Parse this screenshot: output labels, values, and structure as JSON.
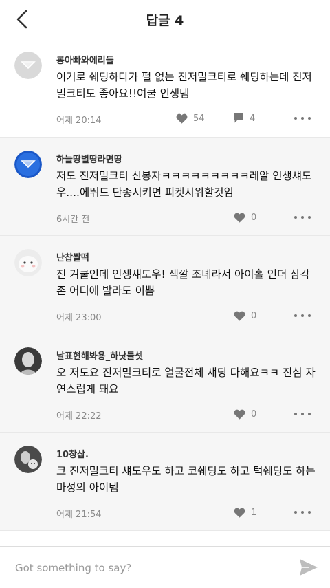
{
  "header": {
    "title": "답글 4",
    "back_icon": "chevron-left-icon"
  },
  "replies": [
    {
      "username": "쿙아빠와에리들",
      "text": "이거로 쉐딩하다가 펄 없는 진저밀크티로 쉐딩하는데 진저밀크티도 좋아요!!여쿨 인생템",
      "time": "어제 20:14",
      "likes": "54",
      "comments": "4"
    },
    {
      "username": "하늘땅별땅라면땅",
      "text": "저도 진저밀크티 신봉자ㅋㅋㅋㅋㅋㅋㅋㅋㅋ레알 인생섀도우....에뛰드 단종시키면 피켓시위할것임",
      "time": "6시간 전",
      "likes": "0"
    },
    {
      "username": "난찹쌀떡",
      "text": "전 겨쿨인데 인생섀도우! 색깔 조녜라서 아이홀 언더 삼각존 어디에 발라도 이쁨",
      "time": "어제 23:00",
      "likes": "0"
    },
    {
      "username": "날표현해봐용_하낫둘셋",
      "text": "오 저도요 진저밀크티로 얼굴전체 섀딩 다해요ㅋㅋ 진심 자연스럽게 돼요",
      "time": "어제 22:22",
      "likes": "0"
    },
    {
      "username": "10창삽.",
      "text": "크 진저밀크티 섀도우도 하고 코쉐딩도 하고 턱쉐딩도 하는 마성의 아이템",
      "time": "어제 21:54",
      "likes": "1"
    }
  ],
  "composer": {
    "placeholder": "Got something to say?",
    "send_icon": "send-icon"
  },
  "colors": {
    "text": "#222222",
    "meta": "#888888",
    "icon": "#777777",
    "alt_bg": "#f6f6f6",
    "divider": "#e8e8e8"
  }
}
